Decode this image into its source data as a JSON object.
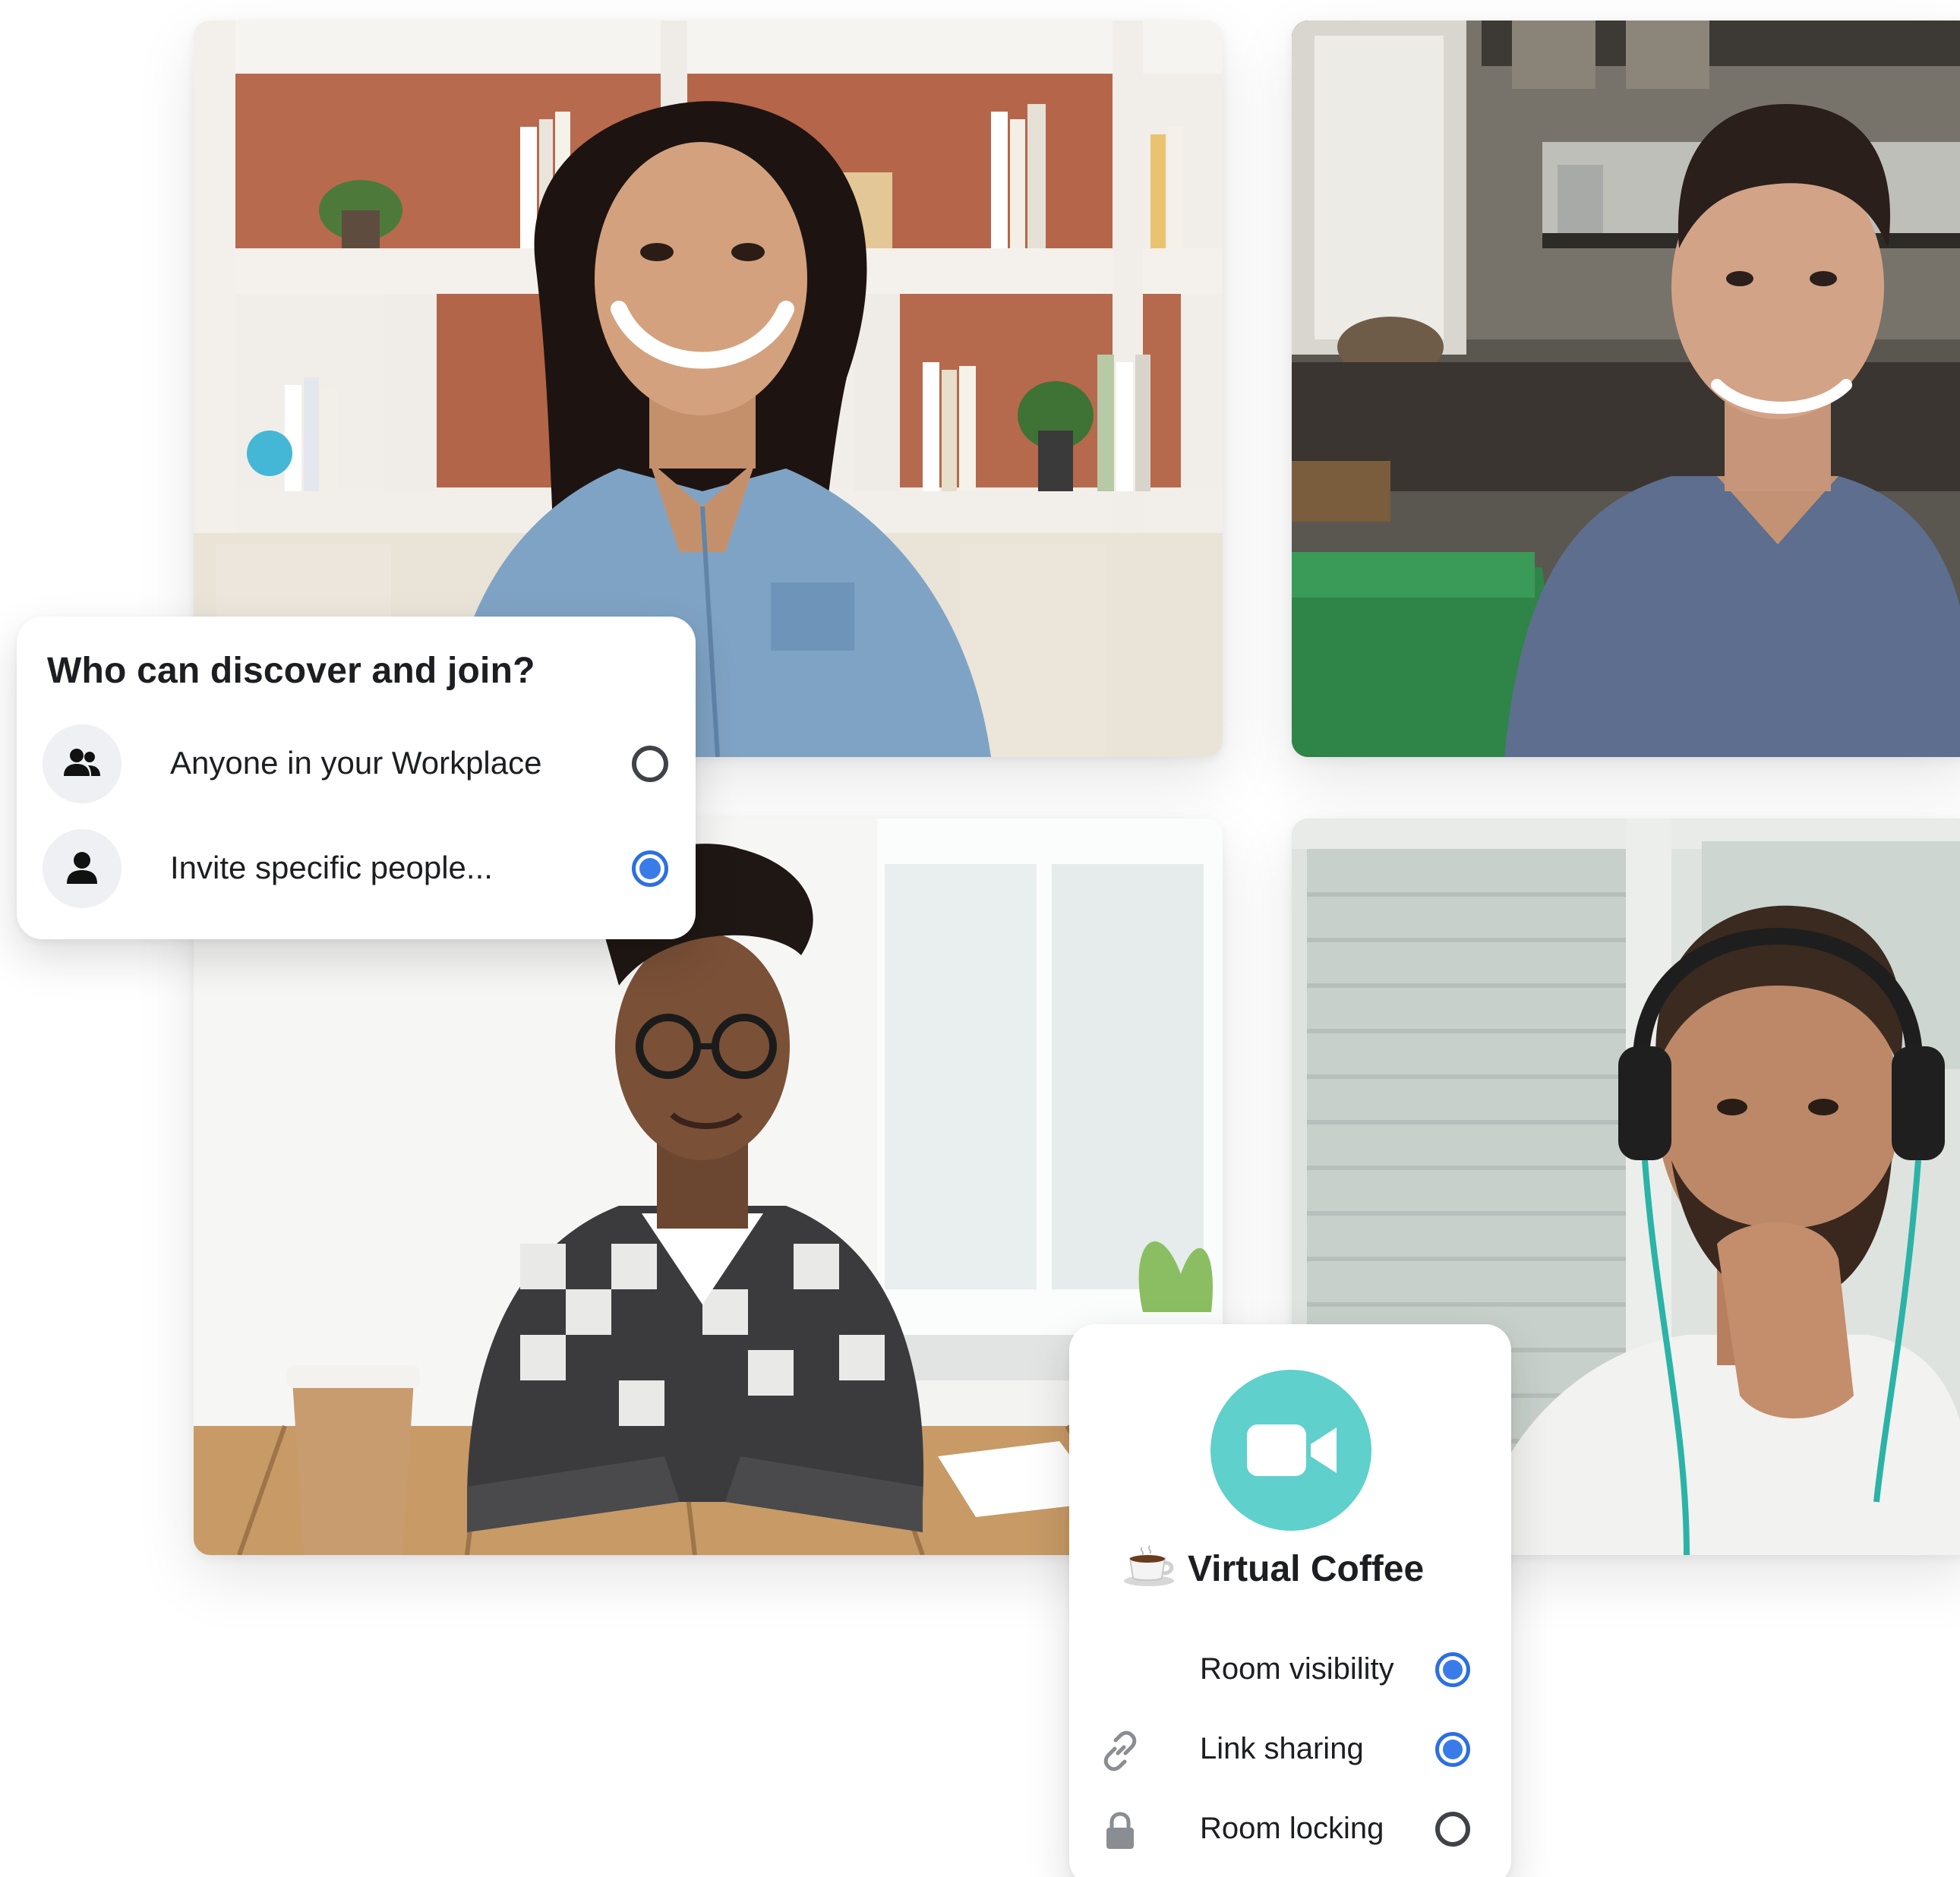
{
  "join_dialog": {
    "title": "Who can discover and join?",
    "options": [
      {
        "label": "Anyone in your Workplace",
        "icon": "people-icon",
        "selected": false
      },
      {
        "label": "Invite specific people...",
        "icon": "person-icon",
        "selected": true
      }
    ]
  },
  "room_card": {
    "icon": "video-camera-icon",
    "emoji": "coffee-cup-icon",
    "title": "Virtual Coffee",
    "settings": [
      {
        "label": "Room visibility",
        "icon": "",
        "enabled": true
      },
      {
        "label": "Link sharing",
        "icon": "link-icon",
        "enabled": true
      },
      {
        "label": "Room locking",
        "icon": "lock-icon",
        "enabled": false
      }
    ]
  },
  "participants": [
    {
      "tile": "woman-bookshelf"
    },
    {
      "tile": "man-kitchen"
    },
    {
      "tile": "woman-plaid-shirt"
    },
    {
      "tile": "man-headphones"
    }
  ],
  "colors": {
    "accent_blue": "#3a7bea",
    "camera_badge": "#5fd0cc",
    "text": "#1c1e21",
    "icon_bg": "#eef0f3"
  }
}
